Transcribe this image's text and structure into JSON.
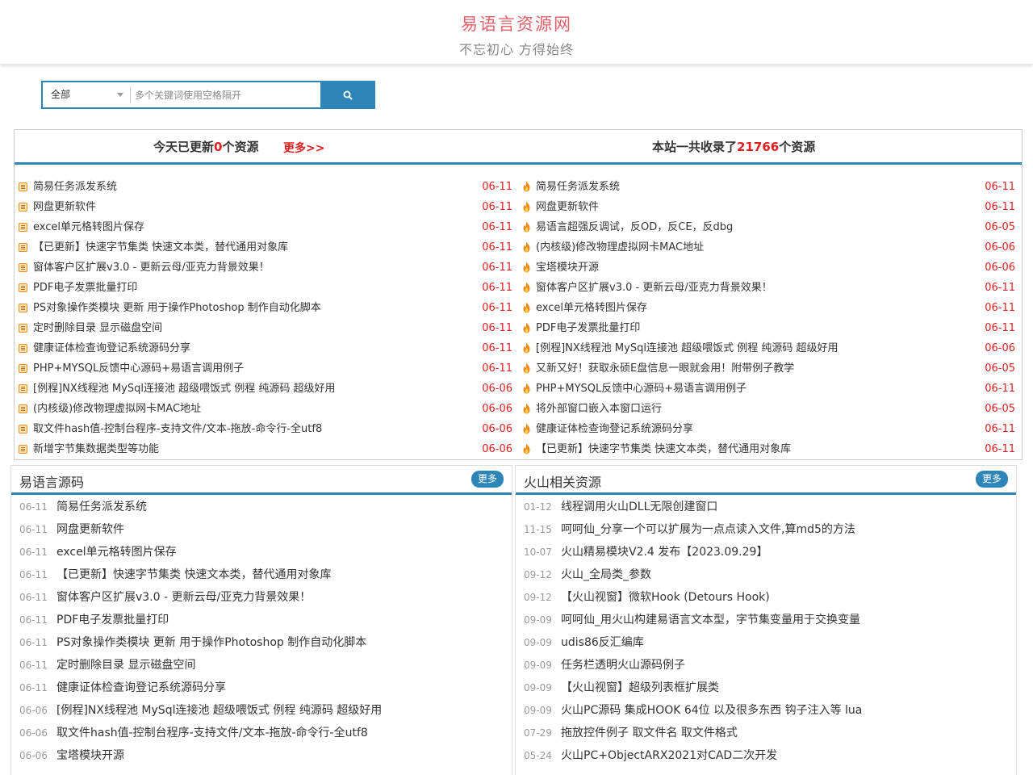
{
  "header": {
    "title": "易语言资源网",
    "slogan": "不忘初心 方得始终"
  },
  "search": {
    "category": "全部",
    "placeholder": "多个关键词使用空格隔开",
    "button_icon": "search-icon"
  },
  "today": {
    "prefix": "今天已更新",
    "count": "0",
    "suffix": "个资源",
    "more": "更多>>"
  },
  "total": {
    "prefix": "本站一共收录了",
    "count": "21766",
    "suffix": "个资源"
  },
  "latest": [
    {
      "title": "简易任务派发系统",
      "date": "06-11"
    },
    {
      "title": "网盘更新软件",
      "date": "06-11"
    },
    {
      "title": "excel单元格转图片保存",
      "date": "06-11"
    },
    {
      "title": "【已更新】快速字节集类 快速文本类，替代通用对象库",
      "date": "06-11"
    },
    {
      "title": "窗体客户区扩展v3.0 - 更新云母/亚克力背景效果！",
      "date": "06-11"
    },
    {
      "title": "PDF电子发票批量打印",
      "date": "06-11"
    },
    {
      "title": "PS对象操作类模块 更新 用于操作Photoshop 制作自动化脚本",
      "date": "06-11"
    },
    {
      "title": "定时删除目录 显示磁盘空间",
      "date": "06-11"
    },
    {
      "title": "健康证体检查询登记系统源码分享",
      "date": "06-11"
    },
    {
      "title": "PHP+MYSQL反馈中心源码+易语言调用例子",
      "date": "06-11"
    },
    {
      "title": "[例程]NX线程池 MySql连接池 超级喂饭式 例程 纯源码 超级好用",
      "date": "06-06"
    },
    {
      "title": "(内核级)修改物理虚拟网卡MAC地址",
      "date": "06-06"
    },
    {
      "title": "取文件hash值-控制台程序-支持文件/文本-拖放-命令行-全utf8",
      "date": "06-06"
    },
    {
      "title": "新增字节集数据类型等功能",
      "date": "06-06"
    }
  ],
  "hot": [
    {
      "title": "简易任务派发系统",
      "date": "06-11"
    },
    {
      "title": "网盘更新软件",
      "date": "06-11"
    },
    {
      "title": "易语言超强反调试，反OD，反CE，反dbg",
      "date": "06-05"
    },
    {
      "title": "(内核级)修改物理虚拟网卡MAC地址",
      "date": "06-06"
    },
    {
      "title": "宝塔模块开源",
      "date": "06-06"
    },
    {
      "title": "窗体客户区扩展v3.0 - 更新云母/亚克力背景效果！",
      "date": "06-11"
    },
    {
      "title": "excel单元格转图片保存",
      "date": "06-11"
    },
    {
      "title": "PDF电子发票批量打印",
      "date": "06-11"
    },
    {
      "title": "[例程]NX线程池 MySql连接池 超级喂饭式 例程 纯源码 超级好用",
      "date": "06-06"
    },
    {
      "title": "又新又好！获取永硕E盘信息一眼就会用！附带例子教学",
      "date": "06-05"
    },
    {
      "title": "PHP+MYSQL反馈中心源码+易语言调用例子",
      "date": "06-11"
    },
    {
      "title": "将外部窗口嵌入本窗口运行",
      "date": "06-05"
    },
    {
      "title": "健康证体检查询登记系统源码分享",
      "date": "06-11"
    },
    {
      "title": "【已更新】快速字节集类 快速文本类，替代通用对象库",
      "date": "06-11"
    }
  ],
  "panel_ey": {
    "title": "易语言源码",
    "more": "更多",
    "items": [
      {
        "date": "06-11",
        "title": "简易任务派发系统"
      },
      {
        "date": "06-11",
        "title": "网盘更新软件"
      },
      {
        "date": "06-11",
        "title": "excel单元格转图片保存"
      },
      {
        "date": "06-11",
        "title": "【已更新】快速字节集类 快速文本类，替代通用对象库"
      },
      {
        "date": "06-11",
        "title": "窗体客户区扩展v3.0 - 更新云母/亚克力背景效果！"
      },
      {
        "date": "06-11",
        "title": "PDF电子发票批量打印"
      },
      {
        "date": "06-11",
        "title": "PS对象操作类模块 更新 用于操作Photoshop 制作自动化脚本"
      },
      {
        "date": "06-11",
        "title": "定时删除目录 显示磁盘空间"
      },
      {
        "date": "06-11",
        "title": "健康证体检查询登记系统源码分享"
      },
      {
        "date": "06-06",
        "title": "[例程]NX线程池 MySql连接池 超级喂饭式 例程 纯源码 超级好用"
      },
      {
        "date": "06-06",
        "title": "取文件hash值-控制台程序-支持文件/文本-拖放-命令行-全utf8"
      },
      {
        "date": "06-06",
        "title": "宝塔模块开源"
      }
    ]
  },
  "panel_hs": {
    "title": "火山相关资源",
    "more": "更多",
    "items": [
      {
        "date": "01-12",
        "title": "线程调用火山DLL无限创建窗口"
      },
      {
        "date": "11-15",
        "title": "呵呵仙_分享一个可以扩展为一点点读入文件,算md5的方法"
      },
      {
        "date": "10-07",
        "title": "火山精易模块V2.4 发布【2023.09.29】"
      },
      {
        "date": "09-12",
        "title": "火山_全局类_参数"
      },
      {
        "date": "09-12",
        "title": "【火山视窗】微软Hook (Detours Hook)"
      },
      {
        "date": "09-09",
        "title": "呵呵仙_用火山构建易语言文本型，字节集变量用于交换变量"
      },
      {
        "date": "09-09",
        "title": "udis86反汇编库"
      },
      {
        "date": "09-09",
        "title": "任务栏透明火山源码例子"
      },
      {
        "date": "09-09",
        "title": "【火山视窗】超级列表框扩展类"
      },
      {
        "date": "09-09",
        "title": "火山PC源码 集成HOOK 64位 以及很多东西 钩子注入等 lua"
      },
      {
        "date": "07-29",
        "title": "拖放控件例子 取文件名 取文件格式"
      },
      {
        "date": "05-24",
        "title": "火山PC+ObjectARX2021对CAD二次开发"
      }
    ]
  },
  "colors": {
    "accent": "#2e86b8",
    "red": "#e02020",
    "title": "#e0606a"
  }
}
